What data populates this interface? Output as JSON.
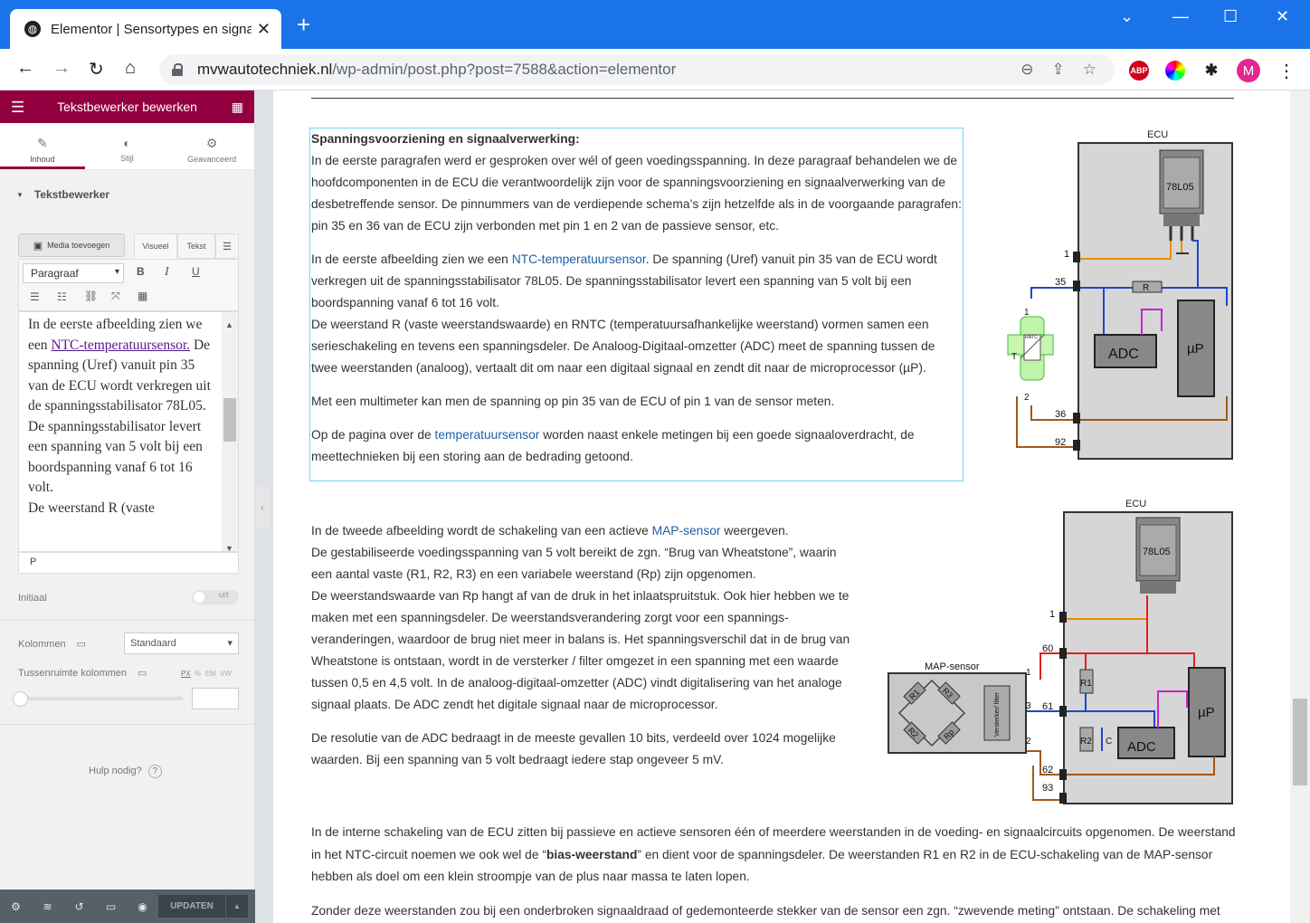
{
  "browser": {
    "tab_title": "Elementor | Sensortypes en signaalverwerking",
    "url_host": "mvwautotechniek.nl",
    "url_path": "/wp-admin/post.php?post=7588&action=elementor",
    "avatar_letter": "M",
    "abp_label": "ABP"
  },
  "panel": {
    "title": "Tekstbewerker bewerken",
    "tabs": [
      "Inhoud",
      "Stijl",
      "Geavanceerd"
    ],
    "section_title": "Tekstbewerker",
    "media_button": "Media toevoegen",
    "visual_tab": "Visueel",
    "text_tab": "Tekst",
    "format_select": "Paragraaf",
    "editor_before_link": "In de eerste afbeelding zien we een ",
    "editor_link": "NTC-temperatuursensor.",
    "editor_after_link": " De spanning (Uref) vanuit pin 35 van de ECU wordt verkregen uit de spanningsstabilisator 78L05. De spanningsstabilisator levert een spanning van 5 volt bij een boordspanning vanaf 6 tot 16 volt.",
    "editor_line2": "De weerstand R (vaste",
    "path_tag": "P",
    "initial_label": "Initiaal",
    "toggle_off": "UIT",
    "columns_label": "Kolommen",
    "columns_value": "Standaard",
    "column_gap_label": "Tussenruimte kolommen",
    "units": [
      "PX",
      "%",
      "EM",
      "VW"
    ],
    "help": "Hulp nodig?",
    "update_button": "UPDATEN"
  },
  "content": {
    "block1": {
      "heading": "Spanningsvoorziening en signaalverwerking:",
      "p1": "In de eerste paragrafen werd er gesproken over wél of geen voedingsspanning. In deze paragraaf behandelen we de hoofdcomponenten in de ECU die verantwoordelijk zijn voor de spanningsvoorziening en signaalverwerking van de desbetreffende sensor. De pinnummers van de verdiepende schema’s zijn hetzelfde als in de voorgaande paragrafen: pin 35 en 36 van de ECU zijn verbonden met pin 1 en 2 van de passieve sensor, etc.",
      "p2_before": "In de eerste afbeelding zien we een ",
      "p2_link": "NTC-temperatuursensor",
      "p2_after": ". De spanning (Uref) vanuit pin 35 van de ECU wordt verkregen uit de spanningsstabilisator 78L05. De spanningsstabilisator levert een spanning van 5 volt bij een boordspanning vanaf 6 tot 16 volt.",
      "p2_line2": "De weerstand R (vaste weerstandswaarde) en RNTC (temperatuursafhankelijke weerstand) vormen samen een serieschakeling en tevens een spanningsdeler. De Analoog-Digitaal-omzetter (ADC) meet de spanning tussen de twee weerstanden (analoog), vertaalt dit om naar een digitaal signaal en zendt dit naar de microprocessor (µP).",
      "p3": "Met een multimeter kan men de spanning op pin 35 van de ECU of pin 1 van de sensor meten.",
      "p4_before": "Op de pagina over de ",
      "p4_link": "temperatuursensor",
      "p4_after": " worden naast enkele metingen bij een goede signaaloverdracht, de meettechnieken bij een storing aan de bedrading getoond."
    },
    "block2": {
      "l1_before": "In de tweede afbeelding wordt de schakeling van een actieve ",
      "l1_link": "MAP-sensor",
      "l1_after": " weergeven.",
      "l2": "De gestabiliseerde voedingsspanning van 5 volt bereikt de zgn. “Brug van Wheatstone”, waarin een aantal vaste (R1, R2, R3) en een variabele weerstand (Rp) zijn opgenomen.",
      "l3": "De weerstandswaarde van Rp hangt af van de druk in het inlaatspruitstuk. Ook hier hebben we te maken met een spanningsdeler. De weerstandsverandering zorgt voor een spannings-veranderingen, waardoor de brug niet meer in balans is. Het spanningsverschil dat in de brug van Wheatstone is ontstaan, wordt in de versterker / filter omgezet in een spanning met een waarde tussen 0,5 en 4,5 volt. In de analoog-digitaal-omzetter (ADC) vindt digitalisering van het analoge signaal plaats. De ADC zendt het digitale signaal naar de microprocessor.",
      "p2": "De resolutie van de ADC bedraagt in de meeste gevallen 10 bits, verdeeld over 1024 mogelijke waarden. Bij een spanning van 5 volt bedraagt iedere stap ongeveer 5 mV."
    },
    "block3": {
      "p1_before": "In de interne schakeling van de ECU zitten bij passieve en actieve sensoren één of meerdere weerstanden in de voeding- en signaalcircuits opgenomen. De weerstand in het NTC-circuit noemen we ook wel de “",
      "p1_bold": "bias-weerstand",
      "p1_after": "” en dient voor de spanningsdeler. De weerstanden R1 en R2 in de ECU-schakeling van de MAP-sensor hebben als doel om een klein stroompje van de plus naar massa te laten lopen.",
      "p2": "Zonder deze weerstanden zou bij een onderbroken signaaldraad of gedemonteerde stekker van de sensor een zgn. “zwevende meting” ontstaan. De schakeling met"
    },
    "diagram1": {
      "ecu": "ECU",
      "reg": "78L05",
      "r": "R",
      "adc": "ADC",
      "up": "µP",
      "rntc": "RNTC",
      "t": "T",
      "pins": [
        "1",
        "35",
        "36",
        "92"
      ],
      "spins": [
        "1",
        "2"
      ]
    },
    "diagram2": {
      "ecu": "ECU",
      "reg": "78L05",
      "map": "MAP-sensor",
      "r1": "R1",
      "r2": "R2",
      "r3": "R3",
      "rp": "Rp",
      "amp": "Versterker/ filter",
      "c": "C",
      "adc": "ADC",
      "up": "µP",
      "pins": [
        "1",
        "60",
        "61",
        "62",
        "93"
      ],
      "spins": [
        "1",
        "3",
        "2"
      ]
    }
  }
}
